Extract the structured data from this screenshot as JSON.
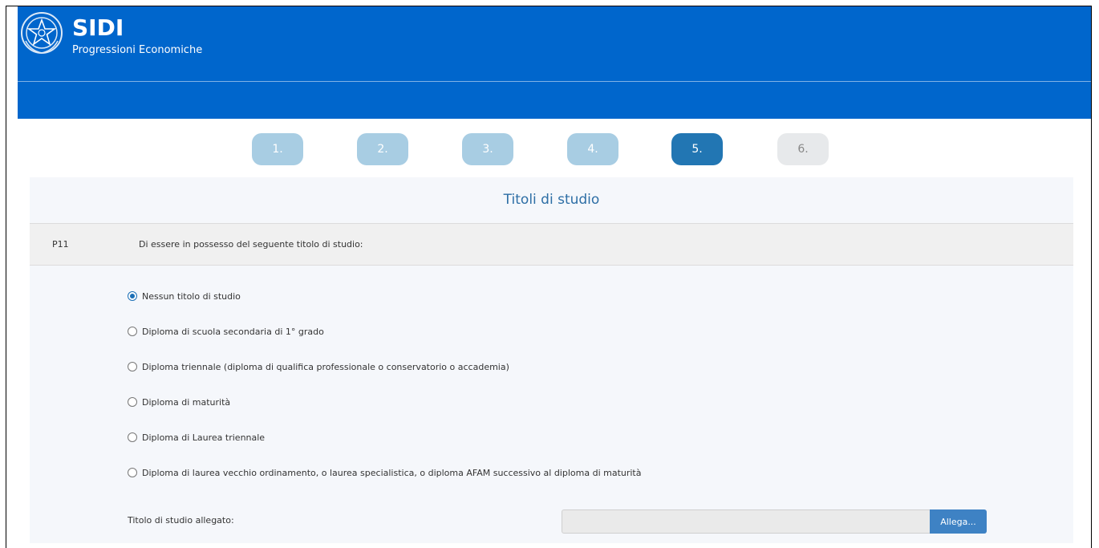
{
  "header": {
    "title": "SIDI",
    "subtitle": "Progressioni Economiche",
    "logo_icon": "italian-republic-emblem-icon",
    "bg_color": "#0066cc"
  },
  "steps": [
    {
      "label": "1.",
      "state": "done"
    },
    {
      "label": "2.",
      "state": "done"
    },
    {
      "label": "3.",
      "state": "done"
    },
    {
      "label": "4.",
      "state": "done"
    },
    {
      "label": "5.",
      "state": "active"
    },
    {
      "label": "6.",
      "state": "todo"
    }
  ],
  "section": {
    "title": "Titoli di studio",
    "question_code": "P11",
    "question_text": "Di essere in possesso del seguente titolo di studio:",
    "options": [
      {
        "label": "Nessun titolo di studio",
        "checked": true
      },
      {
        "label": "Diploma di scuola secondaria di 1° grado",
        "checked": false
      },
      {
        "label": "Diploma triennale (diploma di qualifica professionale o conservatorio o accademia)",
        "checked": false
      },
      {
        "label": "Diploma di maturità",
        "checked": false
      },
      {
        "label": "Diploma di Laurea triennale",
        "checked": false
      },
      {
        "label": "Diploma di laurea vecchio ordinamento, o laurea specialistica, o diploma AFAM successivo al diploma di maturità",
        "checked": false
      }
    ],
    "attachment_label": "Titolo di studio allegato:",
    "attachment_value": "",
    "attach_button": "Allega..."
  }
}
